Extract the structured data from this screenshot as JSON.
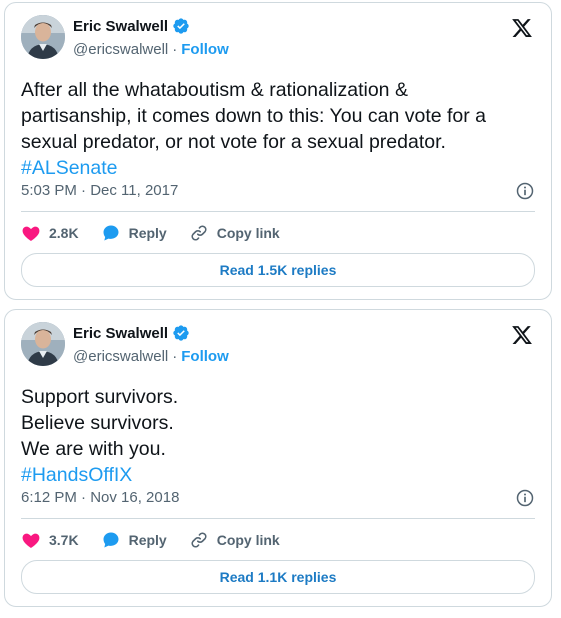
{
  "tweets": [
    {
      "author_name": "Eric Swalwell",
      "handle": "@ericswalwell",
      "separator": "·",
      "follow_label": "Follow",
      "text_lines": [
        "After all the whataboutism & rationalization &",
        "partisanship, it comes down to this: You can vote for a",
        "sexual predator, or not vote for a sexual predator."
      ],
      "hashtag": "#ALSenate",
      "timestamp": "5:03 PM · Dec 11, 2017",
      "likes": "2.8K",
      "reply_label": "Reply",
      "copy_link_label": "Copy link",
      "read_replies_label": "Read 1.5K replies"
    },
    {
      "author_name": "Eric Swalwell",
      "handle": "@ericswalwell",
      "separator": "·",
      "follow_label": "Follow",
      "text_lines": [
        "Support survivors.",
        "Believe survivors.",
        "We are with you."
      ],
      "hashtag": "#HandsOffIX",
      "timestamp": "6:12 PM · Nov 16, 2018",
      "likes": "3.7K",
      "reply_label": "Reply",
      "copy_link_label": "Copy link",
      "read_replies_label": "Read 1.1K replies"
    }
  ],
  "icons": {
    "verified": "verified-badge-icon",
    "x_logo": "x-logo-icon",
    "info": "info-icon",
    "like": "heart-icon",
    "reply": "speech-bubble-icon",
    "copy_link": "link-icon"
  },
  "colors": {
    "accent": "#1d9bf0",
    "like": "#f91880",
    "text": "#0f1419",
    "secondary": "#536471",
    "border": "#cfd9de"
  }
}
